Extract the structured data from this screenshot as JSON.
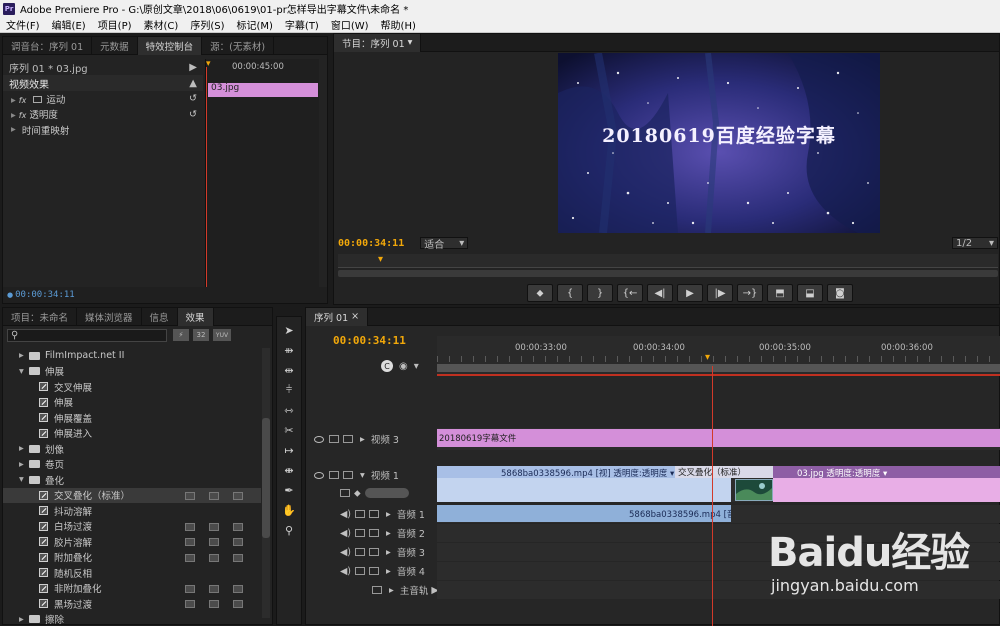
{
  "titlebar": {
    "icon": "Pr",
    "title": "Adobe Premiere Pro - G:\\原创文章\\2018\\06\\0619\\01-pr怎样导出字幕文件\\未命名 *"
  },
  "menu": [
    "文件(F)",
    "编辑(E)",
    "项目(P)",
    "素材(C)",
    "序列(S)",
    "标记(M)",
    "字幕(T)",
    "窗口(W)",
    "帮助(H)"
  ],
  "source_panel": {
    "tabs": [
      "调音台：序列 01",
      "元数据",
      "特效控制台",
      "源：(无素材)"
    ],
    "sequence_label": "序列 01 * 03.jpg",
    "ruler_time": "00:00:45:00",
    "clip_name": "03.jpg",
    "section": "视频效果",
    "effects": [
      {
        "prefix": "fx",
        "name": "运动"
      },
      {
        "prefix": "fx",
        "name": "透明度"
      },
      {
        "prefix": "",
        "name": "时间重映射"
      }
    ],
    "timecode": "00:00:34:11"
  },
  "program": {
    "tab": "节目：序列 01",
    "overlay_text": "20180619百度经验字幕",
    "timecode": "00:00:34:11",
    "fit": "适合",
    "resolution": "1/2",
    "transport": [
      {
        "icon": "marker-icon",
        "glyph": "⬥"
      },
      {
        "icon": "in-point-icon",
        "glyph": "{"
      },
      {
        "icon": "out-point-icon",
        "glyph": "}"
      },
      {
        "icon": "go-to-in-icon",
        "glyph": "{←"
      },
      {
        "icon": "step-back-icon",
        "glyph": "◀|"
      },
      {
        "icon": "play-icon",
        "glyph": "▶"
      },
      {
        "icon": "step-forward-icon",
        "glyph": "|▶"
      },
      {
        "icon": "go-to-out-icon",
        "glyph": "→}"
      },
      {
        "icon": "lift-icon",
        "glyph": "⬒"
      },
      {
        "icon": "extract-icon",
        "glyph": "⬓"
      },
      {
        "icon": "export-frame-icon",
        "glyph": "◙"
      }
    ]
  },
  "effects_panel": {
    "tabs": [
      "项目：未命名",
      "媒体浏览器",
      "信息",
      "效果"
    ],
    "search_buttons": [
      "32",
      "YUV"
    ],
    "tree": [
      {
        "level": 1,
        "type": "folder",
        "label": "FilmImpact.net II",
        "expanded": false
      },
      {
        "level": 1,
        "type": "folder",
        "label": "伸展",
        "expanded": true
      },
      {
        "level": 2,
        "type": "effect",
        "label": "交叉伸展"
      },
      {
        "level": 2,
        "type": "effect",
        "label": "伸展"
      },
      {
        "level": 2,
        "type": "effect",
        "label": "伸展覆盖"
      },
      {
        "level": 2,
        "type": "effect",
        "label": "伸展进入"
      },
      {
        "level": 1,
        "type": "folder",
        "label": "划像",
        "expanded": false
      },
      {
        "level": 1,
        "type": "folder",
        "label": "卷页",
        "expanded": false
      },
      {
        "level": 1,
        "type": "folder",
        "label": "叠化",
        "expanded": true
      },
      {
        "level": 2,
        "type": "effect",
        "label": "交叉叠化（标准）",
        "selected": true,
        "badges": true
      },
      {
        "level": 2,
        "type": "effect",
        "label": "抖动溶解"
      },
      {
        "level": 2,
        "type": "effect",
        "label": "白场过渡",
        "badges": true
      },
      {
        "level": 2,
        "type": "effect",
        "label": "胶片溶解",
        "badges": true
      },
      {
        "level": 2,
        "type": "effect",
        "label": "附加叠化",
        "badges": true
      },
      {
        "level": 2,
        "type": "effect",
        "label": "随机反相"
      },
      {
        "level": 2,
        "type": "effect",
        "label": "非附加叠化",
        "badges": true
      },
      {
        "level": 2,
        "type": "effect",
        "label": "黑场过渡",
        "badges": true
      },
      {
        "level": 1,
        "type": "folder",
        "label": "擦除",
        "expanded": false
      }
    ]
  },
  "timeline": {
    "tab": "序列 01",
    "timecode": "00:00:34:11",
    "ruler": [
      "00:00:33:00",
      "00:00:34:00",
      "00:00:35:00",
      "00:00:36:00"
    ],
    "tracks": [
      {
        "name": "视频 3",
        "kind": "video"
      },
      {
        "name": "视频 1",
        "kind": "video"
      },
      {
        "name": "音频 1",
        "kind": "audio"
      },
      {
        "name": "音频 2",
        "kind": "audio"
      },
      {
        "name": "音频 3",
        "kind": "audio"
      },
      {
        "name": "音频 4",
        "kind": "audio"
      },
      {
        "name": "主音轨",
        "kind": "master"
      }
    ],
    "clips": {
      "v3": "20180619字幕文件",
      "v1_a": "5868ba0338596.mp4 [视] 透明度:透明度 ▾",
      "transition": "交叉叠化（标准）",
      "v1_b": "03.jpg 透明度:透明度 ▾",
      "a1": "5868ba0338596.mp4 [音]"
    }
  },
  "tools": [
    {
      "icon": "selection-tool-icon",
      "glyph": "➤"
    },
    {
      "icon": "track-select-icon",
      "glyph": "⇻"
    },
    {
      "icon": "ripple-edit-icon",
      "glyph": "⇹"
    },
    {
      "icon": "rolling-edit-icon",
      "glyph": "⫩"
    },
    {
      "icon": "rate-stretch-icon",
      "glyph": "⇿"
    },
    {
      "icon": "razor-tool-icon",
      "glyph": "✂"
    },
    {
      "icon": "slip-tool-icon",
      "glyph": "↦"
    },
    {
      "icon": "slide-tool-icon",
      "glyph": "⇼"
    },
    {
      "icon": "pen-tool-icon",
      "glyph": "✒"
    },
    {
      "icon": "hand-tool-icon",
      "glyph": "✋"
    },
    {
      "icon": "zoom-tool-icon",
      "glyph": "⚲"
    }
  ],
  "watermark": {
    "brand": "Baidu经验",
    "url": "jingyan.baidu.com"
  },
  "colors": {
    "accent": "#f2a80a",
    "playhead": "#d23a2a",
    "pink_clip": "#d48fd9",
    "blue_clip": "#8fb0d9",
    "v1_clip": "#b8a0dc"
  }
}
